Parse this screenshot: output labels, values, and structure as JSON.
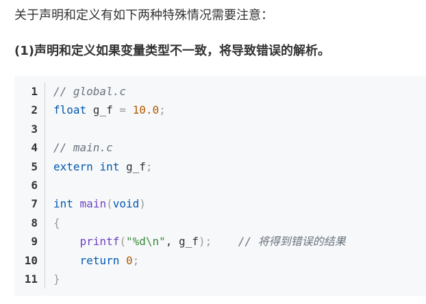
{
  "intro": "关于声明和定义有如下两种特殊情况需要注意：",
  "heading": "(1)声明和定义如果变量类型不一致，将导致错误的解析。",
  "code": {
    "line_numbers": [
      "1",
      "2",
      "3",
      "4",
      "5",
      "6",
      "7",
      "8",
      "9",
      "10",
      "11"
    ],
    "lines": [
      {
        "comment": "// global.c"
      },
      {
        "kw": "float",
        "ident": " g_f ",
        "op": "=",
        "space": " ",
        "num": "10.0",
        "end": ";"
      },
      {},
      {
        "comment": "// main.c"
      },
      {
        "kw1": "extern",
        "kw2": "int",
        "ident": " g_f",
        "end": ";"
      },
      {},
      {
        "kw": "int",
        "fn": "main",
        "open": "(",
        "kw2": "void",
        "close": ")"
      },
      {
        "brace": "{"
      },
      {
        "indent": "    ",
        "fn": "printf",
        "open": "(",
        "str": "\"%d\\n\"",
        "args": ", g_f",
        "close": ");",
        "gap": "    ",
        "comment": "// 将得到错误的结果"
      },
      {
        "indent": "    ",
        "kw": "return",
        "space": " ",
        "num": "0",
        "end": ";"
      },
      {
        "brace": "}"
      }
    ]
  }
}
